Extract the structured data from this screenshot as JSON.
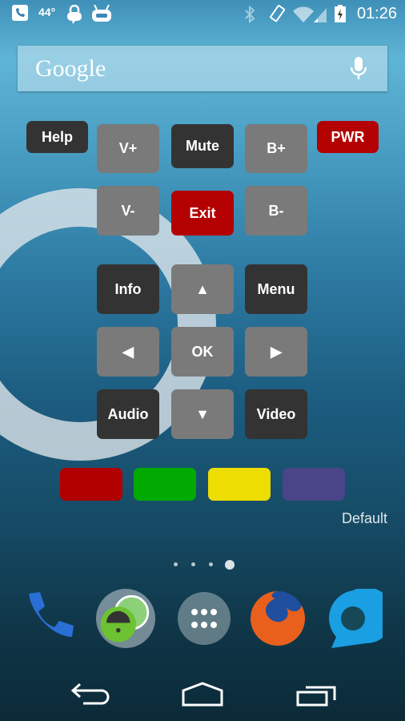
{
  "status_bar": {
    "temperature": "44°",
    "time": "01:26"
  },
  "search": {
    "logo": "Google",
    "mic_icon": "mic-icon"
  },
  "remote": {
    "help": "Help",
    "pwr": "PWR",
    "v_plus": "V+",
    "mute": "Mute",
    "b_plus": "B+",
    "v_minus": "V-",
    "exit": "Exit",
    "b_minus": "B-",
    "info": "Info",
    "menu": "Menu",
    "ok": "OK",
    "audio": "Audio",
    "video": "Video",
    "up": "▲",
    "down": "▼",
    "left": "◀",
    "right": "▶",
    "color_buttons": [
      "#b00000",
      "#00aa00",
      "#eedd00",
      "#4a4488"
    ],
    "profile": "Default"
  },
  "pages": {
    "count": 4,
    "current": 4
  },
  "dock": [
    "phone",
    "secure-messenger",
    "app-drawer",
    "firefox",
    "messenger"
  ],
  "colors": {
    "dark_button": "#333333",
    "gray_button": "#7a7a7a",
    "red_button": "#b30000"
  }
}
